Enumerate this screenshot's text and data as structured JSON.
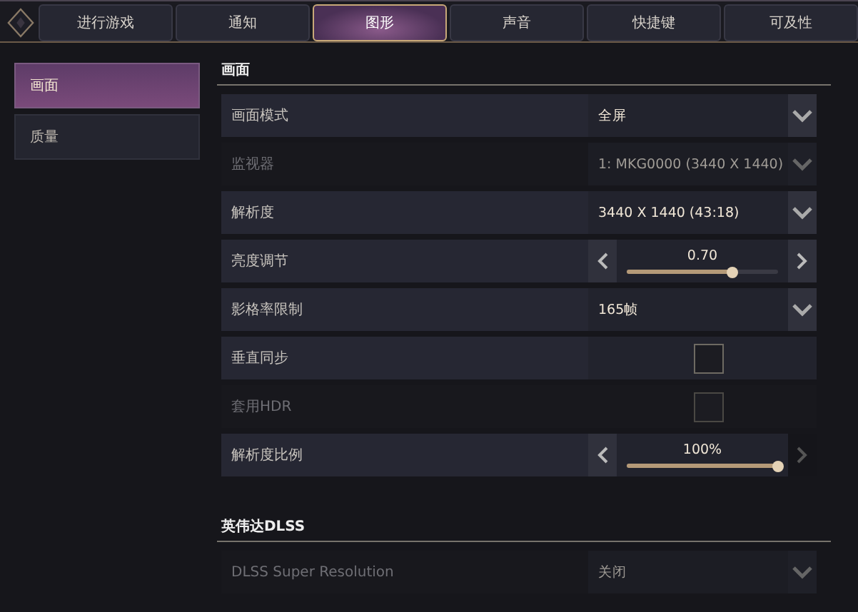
{
  "tabs": [
    {
      "label": "进行游戏",
      "selected": false
    },
    {
      "label": "通知",
      "selected": false
    },
    {
      "label": "图形",
      "selected": true
    },
    {
      "label": "声音",
      "selected": false
    },
    {
      "label": "快捷键",
      "selected": false
    },
    {
      "label": "可及性",
      "selected": false
    }
  ],
  "sidebar": {
    "items": [
      {
        "label": "画面",
        "selected": true
      },
      {
        "label": "质量",
        "selected": false
      }
    ]
  },
  "sections": [
    {
      "title": "画面",
      "rows": [
        {
          "kind": "dropdown",
          "label": "画面模式",
          "value": "全屏",
          "disabled": false
        },
        {
          "kind": "dropdown",
          "label": "监视器",
          "value": "1: MKG0000 (3440 X 1440)",
          "disabled": true
        },
        {
          "kind": "dropdown",
          "label": "解析度",
          "value": "3440 X 1440 (43:18)",
          "disabled": false
        },
        {
          "kind": "slider",
          "label": "亮度调节",
          "value": "0.70",
          "level": 0.7,
          "disabled": false
        },
        {
          "kind": "dropdown",
          "label": "影格率限制",
          "value": "165帧",
          "disabled": false
        },
        {
          "kind": "checkbox",
          "label": "垂直同步",
          "checked": false,
          "disabled": false
        },
        {
          "kind": "checkbox",
          "label": "套用HDR",
          "checked": false,
          "disabled": true
        },
        {
          "kind": "slider",
          "label": "解析度比例",
          "value": "100%",
          "level": 1,
          "disabled": false
        }
      ]
    },
    {
      "title": "英伟达DLSS",
      "rows": [
        {
          "kind": "dropdown",
          "label": "DLSS Super Resolution",
          "value": "关闭",
          "disabled": true
        }
      ]
    }
  ]
}
